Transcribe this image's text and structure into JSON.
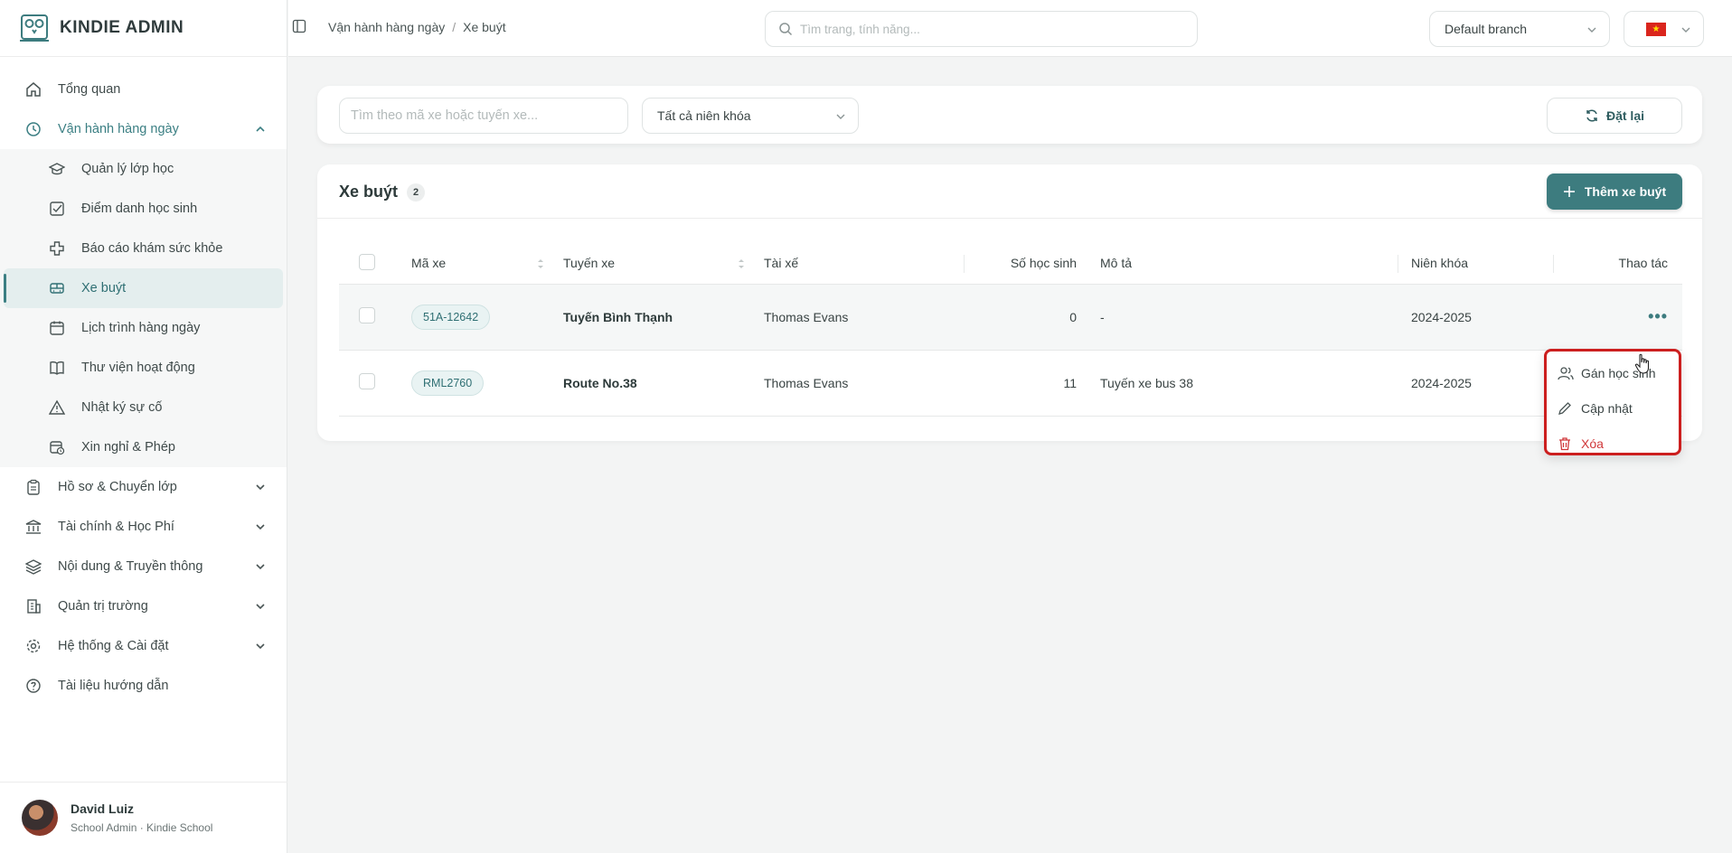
{
  "brand": {
    "name": "KINDIE ADMIN"
  },
  "sidebar": {
    "items": [
      {
        "label": "Tổng quan",
        "icon": "home-icon"
      },
      {
        "label": "Vận hành hàng ngày",
        "icon": "clock-icon",
        "open": true
      },
      {
        "label": "Hồ sơ & Chuyển lớp",
        "icon": "clipboard-icon"
      },
      {
        "label": "Tài chính & Học Phí",
        "icon": "bank-icon"
      },
      {
        "label": "Nội dung & Truyền thông",
        "icon": "layers-icon"
      },
      {
        "label": "Quản trị trường",
        "icon": "building-icon"
      },
      {
        "label": "Hệ thống & Cài đặt",
        "icon": "gear-icon"
      },
      {
        "label": "Tài liệu hướng dẫn",
        "icon": "help-icon"
      }
    ],
    "submenu": [
      {
        "label": "Quản lý lớp học",
        "icon": "graduation-cap-icon"
      },
      {
        "label": "Điểm danh học sinh",
        "icon": "checkbox-icon"
      },
      {
        "label": "Báo cáo khám sức khỏe",
        "icon": "medical-cross-icon"
      },
      {
        "label": "Xe buýt",
        "icon": "bus-icon",
        "active": true
      },
      {
        "label": "Lịch trình hàng ngày",
        "icon": "calendar-icon"
      },
      {
        "label": "Thư viện hoạt động",
        "icon": "book-icon"
      },
      {
        "label": "Nhật ký sự cố",
        "icon": "warning-icon"
      },
      {
        "label": "Xin nghỉ & Phép",
        "icon": "calendar-clock-icon"
      }
    ]
  },
  "user": {
    "name": "David Luiz",
    "role": "School Admin · Kindie School"
  },
  "topbar": {
    "breadcrumb": [
      "Vận hành hàng ngày",
      "Xe buýt"
    ],
    "search_placeholder": "Tìm trang, tính năng...",
    "branch": "Default branch"
  },
  "filters": {
    "search_placeholder": "Tìm theo mã xe hoặc tuyến xe...",
    "year_filter": "Tất cả niên khóa",
    "reset_label": "Đặt lại"
  },
  "table": {
    "title": "Xe buýt",
    "count": "2",
    "add_label": "Thêm xe buýt",
    "columns": [
      "Mã xe",
      "Tuyến xe",
      "Tài xế",
      "Số học sinh",
      "Mô tả",
      "Niên khóa",
      "Thao tác"
    ],
    "rows": [
      {
        "code": "51A-12642",
        "route": "Tuyến Bình Thạnh",
        "driver": "Thomas Evans",
        "students": "0",
        "desc": "-",
        "year": "2024-2025"
      },
      {
        "code": "RML2760",
        "route": "Route No.38",
        "driver": "Thomas Evans",
        "students": "11",
        "desc": "Tuyến xe bus 38",
        "year": "2024-2025"
      }
    ]
  },
  "action_menu": {
    "items": [
      {
        "label": "Gán học sinh",
        "icon": "users-icon"
      },
      {
        "label": "Cập nhật",
        "icon": "pencil-icon"
      },
      {
        "label": "Xóa",
        "icon": "trash-icon"
      }
    ]
  },
  "colors": {
    "accent": "#3d7c7f",
    "danger": "#d0383a",
    "highlight_border": "#cc1f1f"
  }
}
